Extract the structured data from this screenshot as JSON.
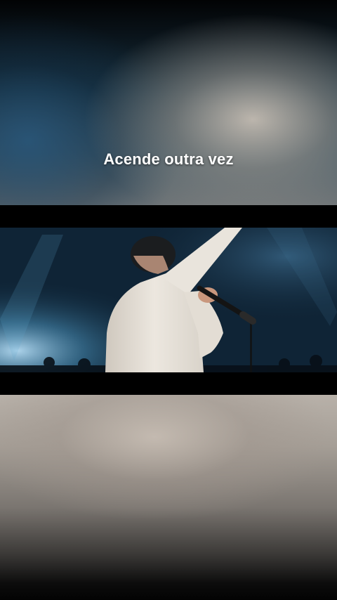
{
  "caption": {
    "text": "Acende outra vez"
  },
  "scene": {
    "subject_icon": "singer-with-microphone-icon",
    "colors": {
      "stage_blue": "#1f4a6e",
      "shirt": "#e8e2d8",
      "hair": "#1b1d1f",
      "letterbox": "#000000"
    }
  }
}
